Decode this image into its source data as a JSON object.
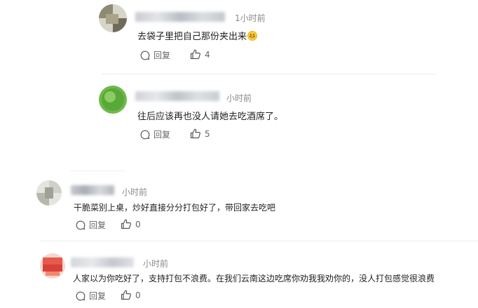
{
  "comments": [
    {
      "time": "1小时前",
      "text": "去袋子里把自己那份夹出来",
      "emoji": "grinning-emoji",
      "reply_label": "回复",
      "likes": "4"
    },
    {
      "time": "小时前",
      "text": "往后应该再也没人请她去吃酒席了。",
      "reply_label": "回复",
      "likes": "5"
    },
    {
      "time": "小时前",
      "text": "干脆菜别上桌，炒好直接分分打包好了，带回家去吃吧",
      "reply_label": "回复",
      "likes": "0"
    },
    {
      "time": "小时前",
      "text": "人家以为你吃好了，支持打包不浪费。在我们云南这边吃席你劝我我劝你的，没人打包感觉很浪费",
      "reply_label": "回复",
      "likes": "0"
    }
  ],
  "icons": {
    "reply": "reply-bubble-icon",
    "like": "thumbs-up-icon"
  }
}
